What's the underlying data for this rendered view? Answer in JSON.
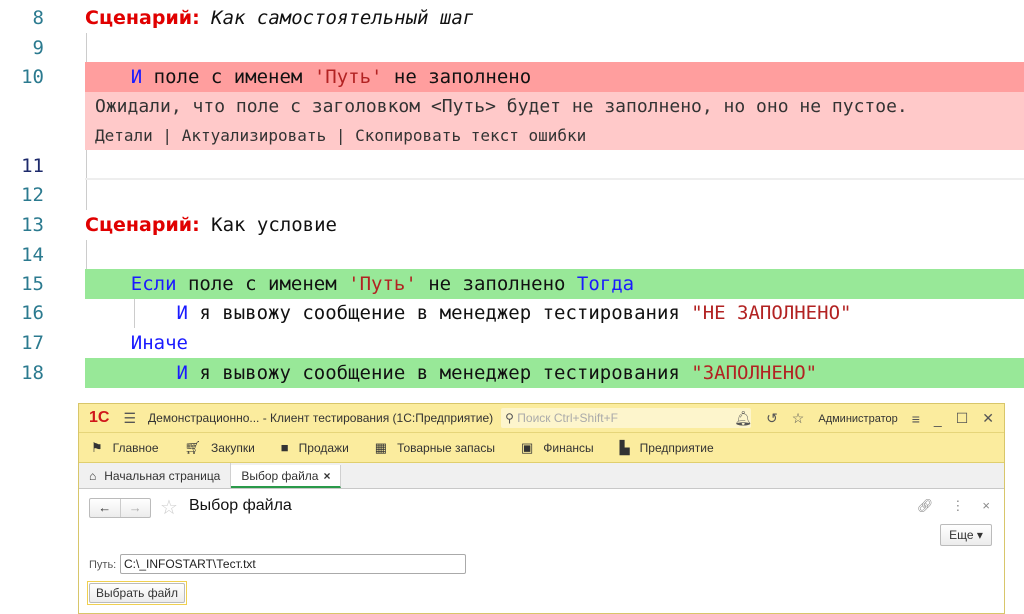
{
  "editor": {
    "lines": [
      {
        "num": "8",
        "keyword": "Сценарий:",
        "text": " Как самостоятельный шаг"
      },
      {
        "num": "9"
      },
      {
        "num": "10",
        "kw": "И",
        "a": " поле с именем ",
        "str": "'Путь'",
        "b": " не заполнено"
      },
      {
        "num": "11"
      },
      {
        "num": "12"
      },
      {
        "num": "13",
        "keyword": "Сценарий:",
        "text": " Как условие"
      },
      {
        "num": "14"
      },
      {
        "num": "15",
        "kw": "Если",
        "a": " поле с именем ",
        "str": "'Путь'",
        "b": " не заполнено ",
        "kw2": "Тогда"
      },
      {
        "num": "16",
        "kw": "И",
        "a": " я вывожу сообщение в менеджер тестирования ",
        "str": "\"НЕ ЗАПОЛНЕНО\""
      },
      {
        "num": "17",
        "kw": "Иначе"
      },
      {
        "num": "18",
        "kw": "И",
        "a": " я вывожу сообщение в менеджер тестирования ",
        "str": "\"ЗАПОЛНЕНО\""
      }
    ],
    "error": {
      "message": "Ожидали, что поле с заголовком <Путь> будет не заполнено, но оно не пустое.",
      "details": "Детали",
      "sep": " | ",
      "actualize": "Актуализировать",
      "copy": "Скопировать текст ошибки"
    },
    "colors": {
      "error_line": "#ff9e9e",
      "error_box": "#ffc9c9",
      "success_line": "#98e898"
    }
  },
  "app": {
    "logo": "1С",
    "title": "Демонстрационно...  - Клиент тестирования (1С:Предприятие)",
    "search_placeholder": "Поиск Ctrl+Shift+F",
    "user": "Администратор",
    "menu": [
      {
        "label": "Главное",
        "icon": "flag-icon"
      },
      {
        "label": "Закупки",
        "icon": "cart-icon"
      },
      {
        "label": "Продажи",
        "icon": "bag-icon"
      },
      {
        "label": "Товарные запасы",
        "icon": "grid-icon"
      },
      {
        "label": "Финансы",
        "icon": "wallet-icon"
      },
      {
        "label": "Предприятие",
        "icon": "factory-icon"
      }
    ],
    "tabs": [
      {
        "label": "Начальная страница"
      },
      {
        "label": "Выбор файла",
        "close": "×"
      }
    ],
    "form": {
      "title": "Выбор файла",
      "more": "Еще ▾",
      "path_label": "Путь:",
      "path_value": "C:\\_INFOSTART\\Тест.txt",
      "choose_button": "Выбрать файл"
    }
  }
}
